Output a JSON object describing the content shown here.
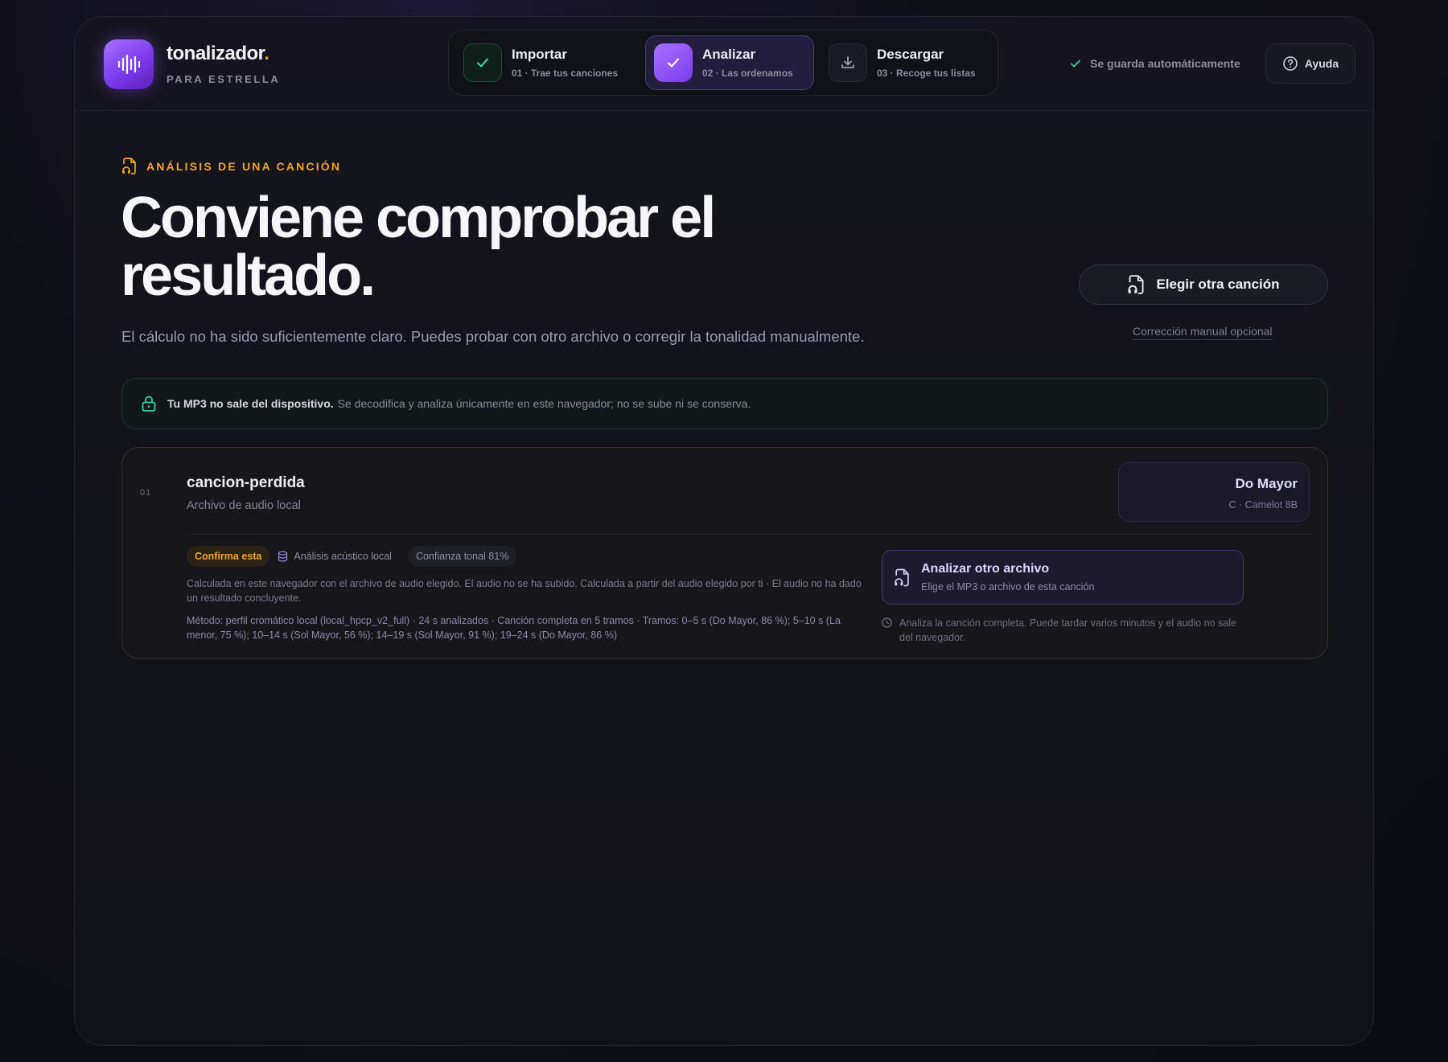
{
  "brand": {
    "name": "tonalizador",
    "dot": ".",
    "subtitle": "PARA ESTRELLA",
    "logo_icon": "waveform-icon"
  },
  "steps": [
    {
      "label": "Importar",
      "sub": "01 · Trae tus canciones",
      "state": "done",
      "icon": "check-icon"
    },
    {
      "label": "Analizar",
      "sub": "02 · Las ordenamos",
      "state": "active",
      "icon": "check-icon"
    },
    {
      "label": "Descargar",
      "sub": "03 · Recoge tus listas",
      "state": "pending",
      "icon": "download-icon"
    }
  ],
  "header": {
    "autosave": "Se guarda automáticamente",
    "help": "Ayuda"
  },
  "main": {
    "eyebrow": "ANÁLISIS DE UNA CANCIÓN",
    "title": "Conviene comprobar el resultado.",
    "subtitle": "El cálculo no ha sido suficientemente claro. Puedes probar con otro archivo o corregir la tonalidad manualmente.",
    "choose_button": "Elegir otra canción",
    "manual_link": "Corrección manual opcional"
  },
  "privacy": {
    "strong": "Tu MP3 no sale del dispositivo.",
    "text": "Se decodifica y analiza únicamente en este navegador; no se sube ni se conserva."
  },
  "song": {
    "number": "01",
    "name": "cancion-perdida",
    "type": "Archivo de audio local",
    "key": "Do Mayor",
    "key_sub": "C · Camelot 8B",
    "tags": {
      "warn": "Confirma esta",
      "source": "Análisis acústico local",
      "confidence": "Confianza tonal 81%"
    },
    "detail": "Calculada en este navegador con el archivo de audio elegido. El audio no se ha subido. Calculada a partir del audio elegido por ti · El audio no ha dado un resultado concluyente.",
    "method": "Método: perfil cromático local (local_hpcp_v2_full) · 24 s analizados · Canción completa en 5 tramos · Tramos: 0–5 s (Do Mayor, 86 %); 5–10 s (La menor, 75 %); 10–14 s (Sol Mayor, 56 %); 14–19 s (Sol Mayor, 91 %); 19–24 s (Do Mayor, 86 %)",
    "analyze_title": "Analizar otro archivo",
    "analyze_sub": "Elige el MP3 o archivo de esta canción",
    "note": "Analiza la canción completa. Puede tardar varios minutos y el audio no sale del navegador."
  },
  "colors": {
    "accent": "#7c3aed",
    "warning": "#f5a524",
    "success": "#34d399"
  }
}
